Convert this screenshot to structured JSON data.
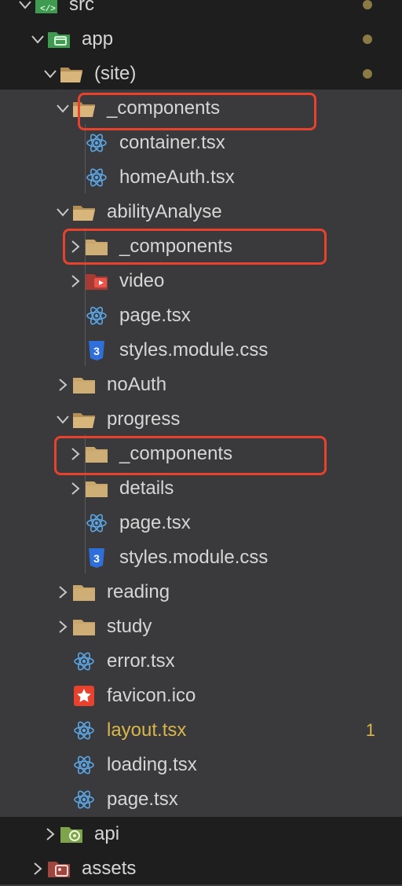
{
  "tree": [
    {
      "name": "src",
      "icon": "src-folder-icon",
      "expanded": true,
      "modified": true
    },
    {
      "name": "app",
      "icon": "app-folder-icon",
      "expanded": true,
      "modified": true
    },
    {
      "name": "(site)",
      "icon": "folder-open-icon",
      "expanded": true,
      "modified": true
    },
    {
      "name": "_components",
      "icon": "folder-open-icon",
      "expanded": true
    },
    {
      "name": "container.tsx",
      "icon": "react-icon"
    },
    {
      "name": "homeAuth.tsx",
      "icon": "react-icon"
    },
    {
      "name": "abilityAnalyse",
      "icon": "folder-open-icon",
      "expanded": true
    },
    {
      "name": "_components",
      "icon": "folder-icon",
      "expanded": false
    },
    {
      "name": "video",
      "icon": "video-folder-icon",
      "expanded": false
    },
    {
      "name": "page.tsx",
      "icon": "react-icon"
    },
    {
      "name": "styles.module.css",
      "icon": "css-icon"
    },
    {
      "name": "noAuth",
      "icon": "folder-icon",
      "expanded": false
    },
    {
      "name": "progress",
      "icon": "folder-open-icon",
      "expanded": true
    },
    {
      "name": "_components",
      "icon": "folder-icon",
      "expanded": false
    },
    {
      "name": "details",
      "icon": "folder-icon",
      "expanded": false
    },
    {
      "name": "page.tsx",
      "icon": "react-icon"
    },
    {
      "name": "styles.module.css",
      "icon": "css-icon"
    },
    {
      "name": "reading",
      "icon": "folder-icon",
      "expanded": false
    },
    {
      "name": "study",
      "icon": "folder-icon",
      "expanded": false
    },
    {
      "name": "error.tsx",
      "icon": "react-icon"
    },
    {
      "name": "favicon.ico",
      "icon": "star-icon"
    },
    {
      "name": "layout.tsx",
      "icon": "react-icon",
      "warning": true,
      "badge": "1"
    },
    {
      "name": "loading.tsx",
      "icon": "react-icon"
    },
    {
      "name": "page.tsx",
      "icon": "react-icon"
    },
    {
      "name": "api",
      "icon": "api-folder-icon",
      "expanded": false
    },
    {
      "name": "assets",
      "icon": "assets-folder-icon",
      "expanded": false
    }
  ],
  "colors": {
    "sidebar_bg": "#3a3a3c",
    "outer_bg": "#1e1e1f",
    "label": "#d6d6d6",
    "warning": "#d9b64a",
    "highlight_box": "#e8422f",
    "folder": "#c9a66b",
    "react": "#5aa6e6",
    "css": "#2f6fdb"
  }
}
